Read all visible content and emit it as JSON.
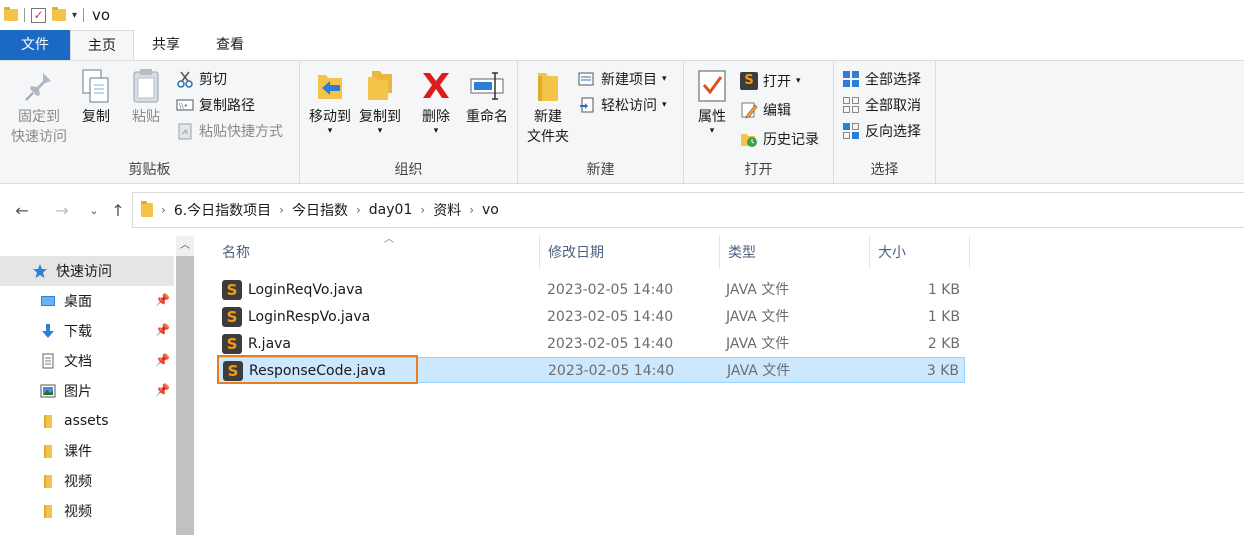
{
  "window": {
    "title": "vo"
  },
  "ribbon_tabs": [
    "文件",
    "主页",
    "共享",
    "查看"
  ],
  "clipboard": {
    "pin_label_1": "固定到",
    "pin_label_2": "快速访问",
    "copy": "复制",
    "paste": "粘贴",
    "cut": "剪切",
    "copy_path": "复制路径",
    "paste_shortcut": "粘贴快捷方式",
    "group": "剪贴板"
  },
  "organize": {
    "move_to": "移动到",
    "copy_to": "复制到",
    "delete": "删除",
    "rename": "重命名",
    "group": "组织"
  },
  "new": {
    "new_folder_1": "新建",
    "new_folder_2": "文件夹",
    "new_item": "新建项目",
    "easy_access": "轻松访问",
    "group": "新建"
  },
  "open": {
    "properties": "属性",
    "open": "打开",
    "edit": "编辑",
    "history": "历史记录",
    "group": "打开"
  },
  "select": {
    "select_all": "全部选择",
    "select_none": "全部取消",
    "invert": "反向选择",
    "group": "选择"
  },
  "breadcrumb": [
    "6.今日指数项目",
    "今日指数",
    "day01",
    "资料",
    "vo"
  ],
  "nav": {
    "items": [
      {
        "label": "快速访问",
        "icon": "star-icon"
      },
      {
        "label": "桌面",
        "icon": "desktop-icon"
      },
      {
        "label": "下载",
        "icon": "download-icon"
      },
      {
        "label": "文档",
        "icon": "document-icon"
      },
      {
        "label": "图片",
        "icon": "picture-icon"
      },
      {
        "label": "assets",
        "icon": "folder-icon"
      },
      {
        "label": "课件",
        "icon": "folder-icon"
      },
      {
        "label": "视频",
        "icon": "folder-icon"
      },
      {
        "label": "视频",
        "icon": "folder-icon"
      }
    ]
  },
  "columns": {
    "name": "名称",
    "date": "修改日期",
    "type": "类型",
    "size": "大小"
  },
  "files": [
    {
      "name": "LoginReqVo.java",
      "date": "2023-02-05 14:40",
      "type": "JAVA 文件",
      "size": "1 KB"
    },
    {
      "name": "LoginRespVo.java",
      "date": "2023-02-05 14:40",
      "type": "JAVA 文件",
      "size": "1 KB"
    },
    {
      "name": "R.java",
      "date": "2023-02-05 14:40",
      "type": "JAVA 文件",
      "size": "2 KB"
    },
    {
      "name": "ResponseCode.java",
      "date": "2023-02-05 14:40",
      "type": "JAVA 文件",
      "size": "3 KB"
    }
  ],
  "colors": {
    "file_tab": "#1a6ac3",
    "selection": "#cce8ff",
    "highlight_box": "#e67e22"
  }
}
